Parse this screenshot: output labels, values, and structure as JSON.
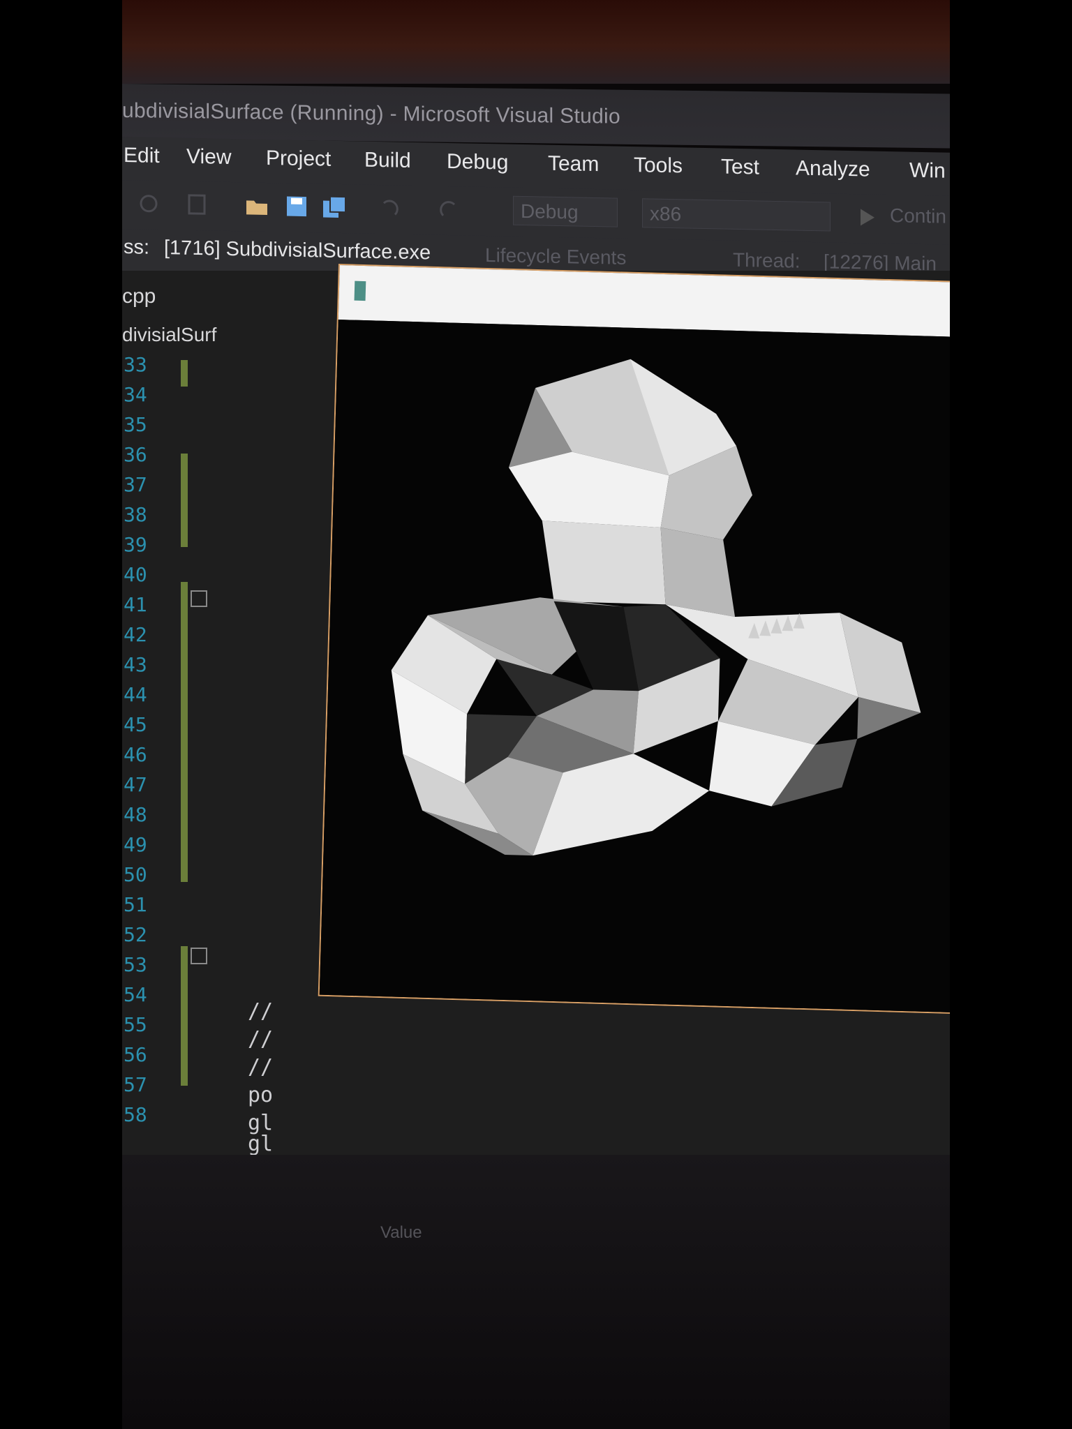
{
  "window": {
    "title": "ubdivisialSurface (Running) - Microsoft Visual Studio"
  },
  "menu": [
    "Edit",
    "View",
    "Project",
    "Build",
    "Debug",
    "Team",
    "Tools",
    "Test",
    "Analyze",
    "Win"
  ],
  "toolbar": {
    "config": "Debug",
    "platform": "x86",
    "continue_label": "Contin",
    "icons": [
      "back-icon",
      "open-folder-icon",
      "save-icon",
      "save-all-icon",
      "undo-icon",
      "redo-icon",
      "play-icon"
    ]
  },
  "process_bar": {
    "process_label": "ss:",
    "process_value": "[1716] SubdivisialSurface.exe",
    "lifecycle": "Lifecycle Events",
    "thread_label": "Thread:",
    "thread_value": "[12276] Main"
  },
  "editor": {
    "tab": "cpp",
    "breadcrumb": "divisialSurf",
    "line_numbers": [
      "33",
      "34",
      "35",
      "36",
      "37",
      "38",
      "39",
      "40",
      "41",
      "42",
      "43",
      "44",
      "45",
      "46",
      "47",
      "48",
      "49",
      "50",
      "51",
      "52",
      "53",
      "54",
      "55",
      "56",
      "57",
      "58"
    ],
    "code_lines": [
      "//",
      "//",
      "//",
      "po",
      "gl",
      "gl"
    ]
  },
  "bottom_panel": {
    "column_header": "Value"
  },
  "app_window": {
    "close_glyph": "×"
  }
}
